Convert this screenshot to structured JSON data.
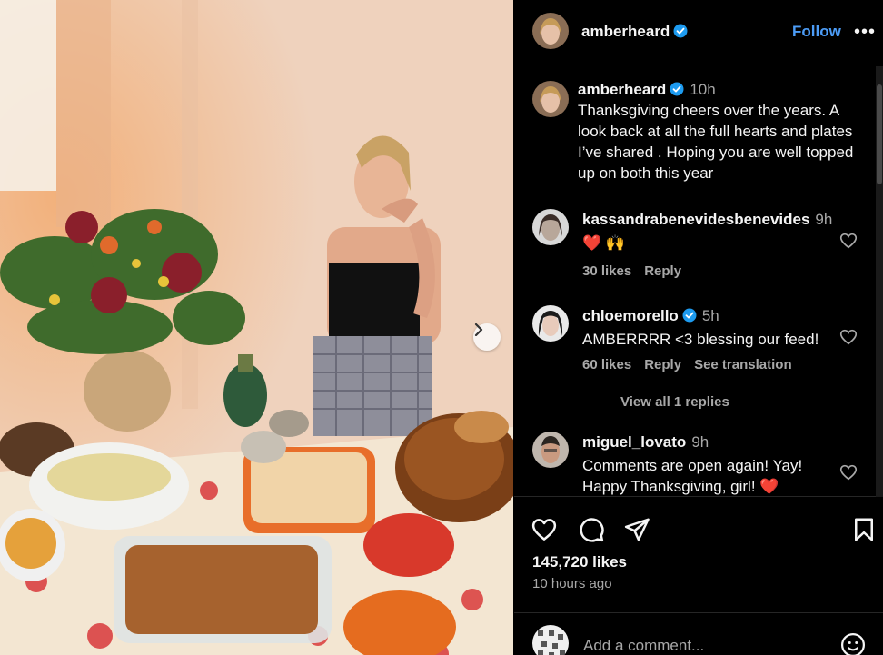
{
  "post": {
    "username": "amberheard",
    "follow_label": "Follow",
    "more_label": "•••",
    "caption": "Thanksgiving cheers over the years. A look back at all the full hearts and plates I’ve shared . Hoping you are well topped up on both this year",
    "caption_time": "10h"
  },
  "comments": [
    {
      "username": "kassandrabenevidesbenevides",
      "time": "9h",
      "text": "❤️ 🙌",
      "likes": "30 likes",
      "reply": "Reply"
    },
    {
      "username": "chloemorello",
      "time": "5h",
      "text": "AMBERRRR <3 blessing our feed!",
      "likes": "60 likes",
      "reply": "Reply",
      "translate": "See translation",
      "view_replies": "View all 1 replies"
    },
    {
      "username": "miguel_lovato",
      "time": "9h",
      "text": "Comments are open again! Yay! Happy Thanksgiving, girl! ❤️"
    }
  ],
  "stats": {
    "likes": "145,720 likes",
    "posted": "10 hours ago"
  },
  "composer": {
    "placeholder": "Add a comment..."
  },
  "colors": {
    "accent": "#4c9cf6",
    "verified": "#1d9bf0",
    "muted": "#a8a8a8",
    "background": "#000000"
  }
}
